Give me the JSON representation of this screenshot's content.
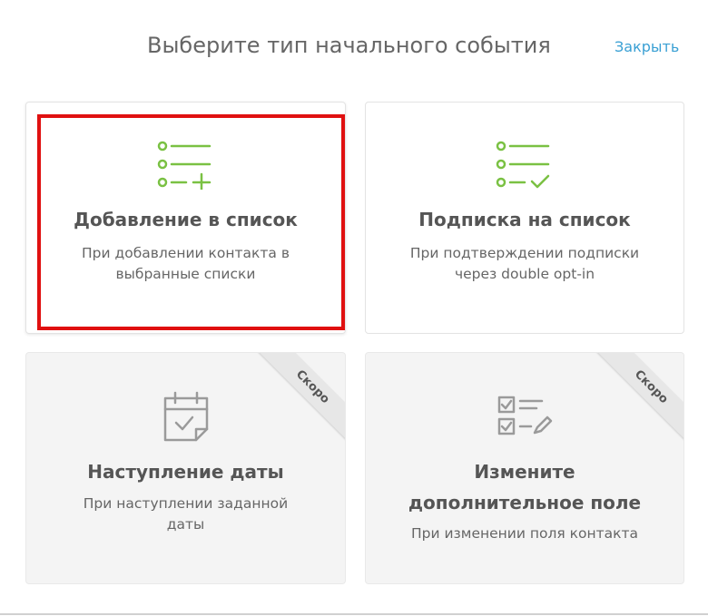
{
  "header": {
    "title": "Выберите тип начального события",
    "close_label": "Закрыть"
  },
  "colors": {
    "accent_green": "#7ac143",
    "link_blue": "#3aa0d4",
    "highlight_red": "#e01010",
    "disabled_icon": "#9a9a9a"
  },
  "cards": [
    {
      "title": "Добавление в список",
      "desc_line1": "При добавлении контакта в",
      "desc_line2": "выбранные списки",
      "icon": "list-add-icon",
      "enabled": true,
      "selected": true
    },
    {
      "title": "Подписка на список",
      "desc_line1": "При подтверждении подписки",
      "desc_line2": "через double opt-in",
      "icon": "list-check-icon",
      "enabled": true,
      "selected": false
    },
    {
      "title": "Наступление даты",
      "desc_line1": "При наступлении заданной",
      "desc_line2": "даты",
      "icon": "calendar-check-icon",
      "enabled": false,
      "badge": "Скоро"
    },
    {
      "title_line1": "Измените",
      "title_line2": "дополнительное поле",
      "desc_line1": "При изменении поля контакта",
      "icon": "checklist-edit-icon",
      "enabled": false,
      "badge": "Скоро"
    }
  ]
}
